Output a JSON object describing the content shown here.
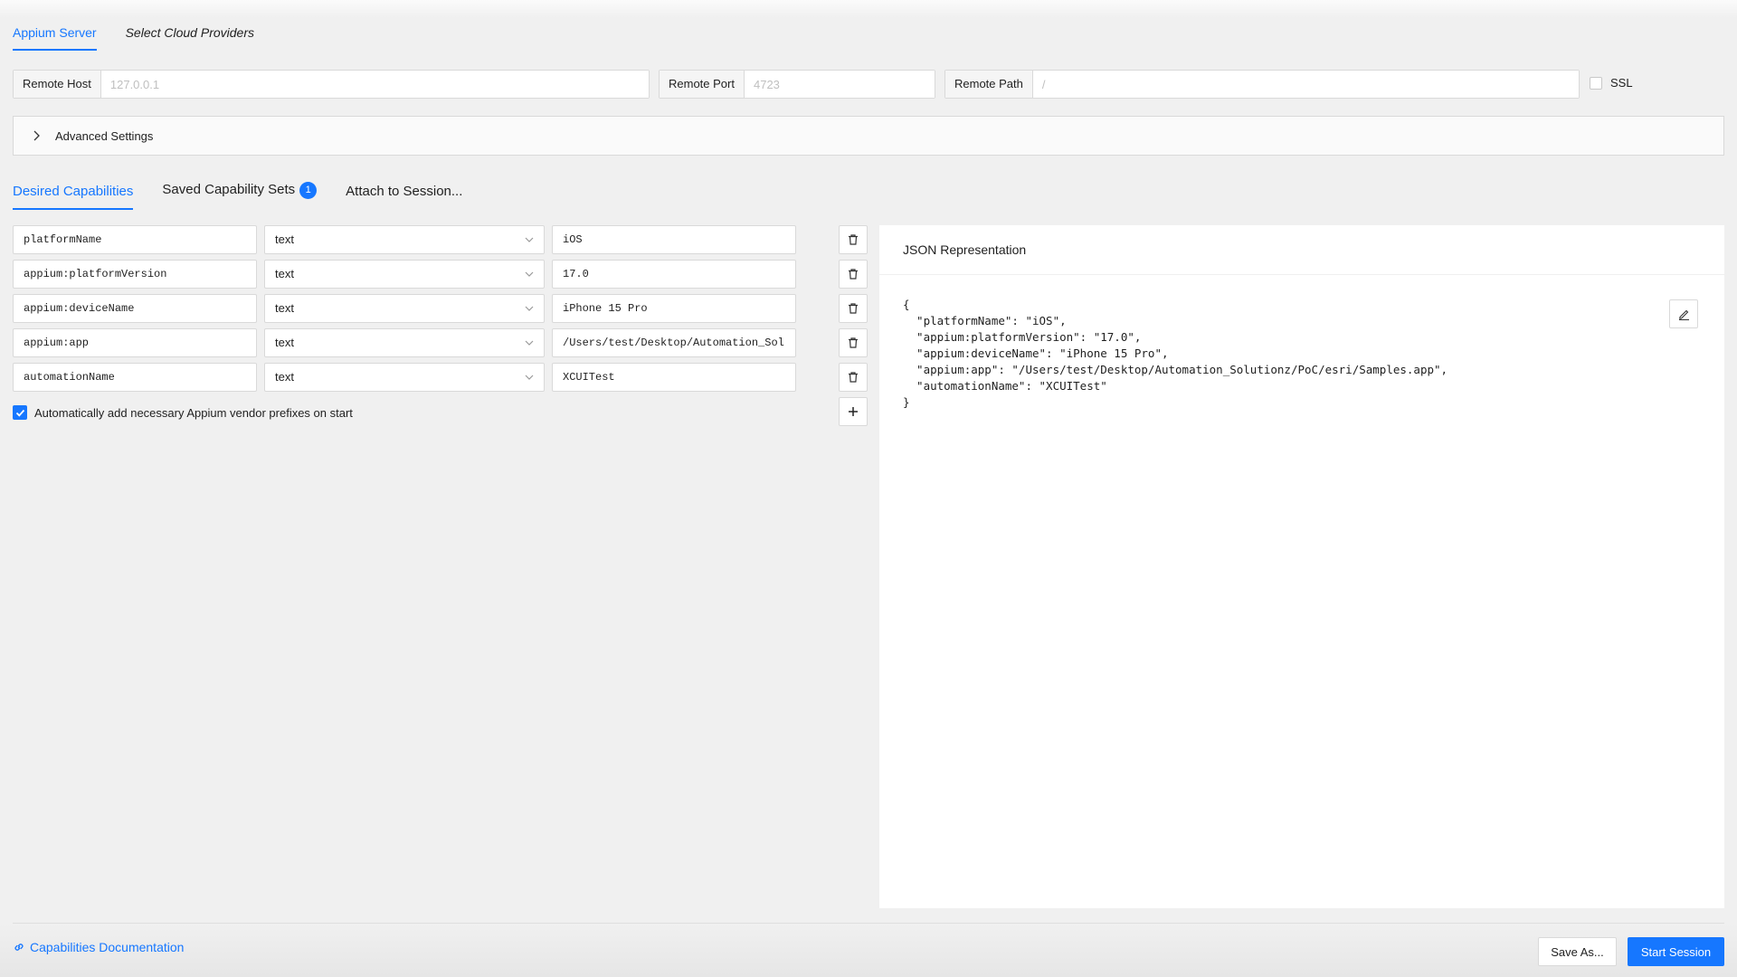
{
  "top_tabs": [
    {
      "label": "Appium Server",
      "active": true
    },
    {
      "label": "Select Cloud Providers",
      "active": false
    }
  ],
  "server": {
    "host_label": "Remote Host",
    "host_placeholder": "127.0.0.1",
    "port_label": "Remote Port",
    "port_placeholder": "4723",
    "path_label": "Remote Path",
    "path_placeholder": "/",
    "ssl_label": "SSL"
  },
  "advanced_label": "Advanced Settings",
  "cap_tabs": {
    "desired": "Desired Capabilities",
    "saved": "Saved Capability Sets",
    "saved_count": "1",
    "attach": "Attach to Session..."
  },
  "capabilities": [
    {
      "name": "platformName",
      "type": "text",
      "value": "iOS"
    },
    {
      "name": "appium:platformVersion",
      "type": "text",
      "value": "17.0"
    },
    {
      "name": "appium:deviceName",
      "type": "text",
      "value": "iPhone 15 Pro"
    },
    {
      "name": "appium:app",
      "type": "text",
      "value": "/Users/test/Desktop/Automation_Sol"
    },
    {
      "name": "automationName",
      "type": "text",
      "value": "XCUITest"
    }
  ],
  "prefix_label": "Automatically add necessary Appium vendor prefixes on start",
  "json_panel": {
    "title": "JSON Representation",
    "content": "{\n  \"platformName\": \"iOS\",\n  \"appium:platformVersion\": \"17.0\",\n  \"appium:deviceName\": \"iPhone 15 Pro\",\n  \"appium:app\": \"/Users/test/Desktop/Automation_Solutionz/PoC/esri/Samples.app\",\n  \"automationName\": \"XCUITest\"\n}"
  },
  "footer": {
    "docs_link": "Capabilities Documentation",
    "save_as": "Save As...",
    "start_session": "Start Session"
  },
  "colors": {
    "accent": "#1677ff",
    "background": "#f0f0f0",
    "panel": "#ffffff",
    "border": "#d9d9d9"
  },
  "icons": [
    "chevron-right-icon",
    "chevron-down-icon",
    "trash-icon",
    "plus-icon",
    "check-icon",
    "edit-icon",
    "link-icon"
  ]
}
